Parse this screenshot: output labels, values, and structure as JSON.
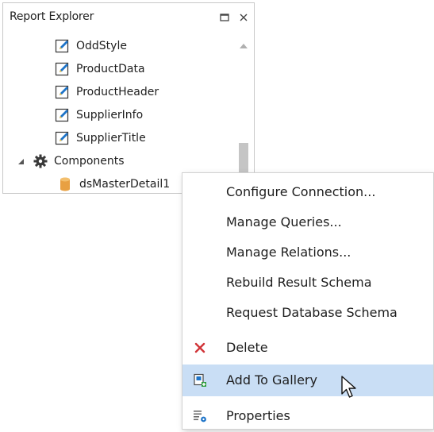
{
  "panel": {
    "title": "Report Explorer",
    "maximize_icon": "maximize-icon",
    "close_icon": "close-icon"
  },
  "tree": {
    "style_items": [
      "OddStyle",
      "ProductData",
      "ProductHeader",
      "SupplierInfo",
      "SupplierTitle"
    ],
    "style_icon": "style-edit-icon",
    "components_label": "Components",
    "components_icon": "gear-icon",
    "component_item": "dsMasterDetail1",
    "component_icon": "database-icon"
  },
  "context_menu": {
    "items": [
      {
        "label": "Configure Connection...",
        "icon": ""
      },
      {
        "label": "Manage Queries...",
        "icon": ""
      },
      {
        "label": "Manage Relations...",
        "icon": ""
      },
      {
        "label": "Rebuild Result Schema",
        "icon": ""
      },
      {
        "label": "Request Database Schema",
        "icon": ""
      },
      {
        "label": "Delete",
        "icon": "delete-icon"
      },
      {
        "label": "Add To Gallery",
        "icon": "add-to-gallery-icon",
        "hovered": true
      },
      {
        "label": "Properties",
        "icon": "properties-icon"
      }
    ]
  },
  "colors": {
    "hover_bg": "#c9def5",
    "delete_red": "#d13438",
    "icon_blue": "#1e74c8",
    "db_orange": "#e8a042"
  }
}
